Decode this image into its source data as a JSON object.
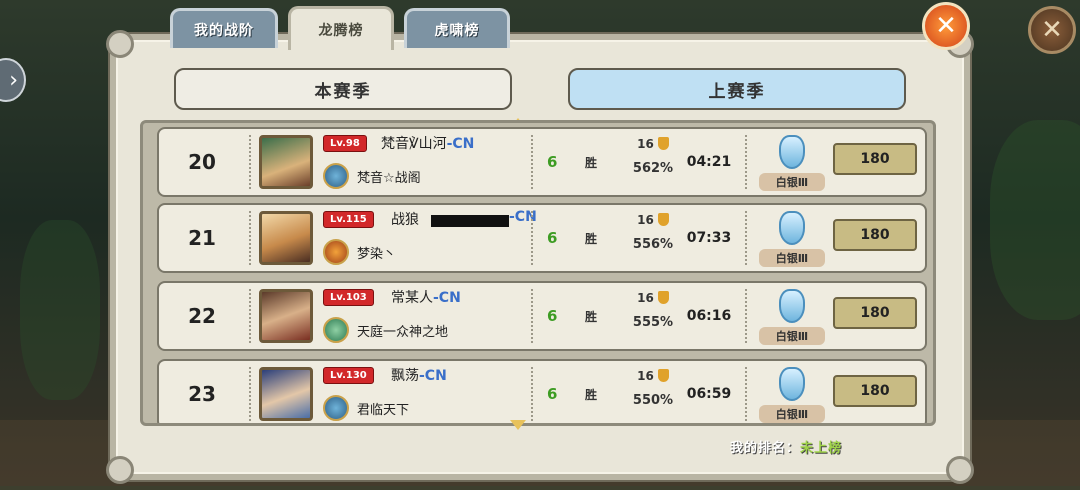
{
  "tabs": [
    {
      "label": "我的战阶",
      "active": false
    },
    {
      "label": "龙腾榜",
      "active": true
    },
    {
      "label": "虎啸榜",
      "active": false
    }
  ],
  "season_buttons": [
    {
      "label": "本赛季",
      "selected": false
    },
    {
      "label": "上赛季",
      "selected": true
    }
  ],
  "rows": [
    {
      "rank": "20",
      "level": "Lv.98",
      "name": "梵音℣山河",
      "server": "-CN",
      "guild": "梵音☆战阁",
      "wins": "6",
      "win_label": "胜",
      "streak": "16",
      "percent": "562%",
      "time": "04:21",
      "tier": "白银Ⅲ",
      "score": "180"
    },
    {
      "rank": "21",
      "level": "Lv.115",
      "name": "战狼",
      "server": "-CN",
      "guild": "梦染丶",
      "wins": "6",
      "win_label": "胜",
      "streak": "16",
      "percent": "556%",
      "time": "07:33",
      "tier": "白银Ⅲ",
      "score": "180"
    },
    {
      "rank": "22",
      "level": "Lv.103",
      "name": "常某人",
      "server": "-CN",
      "guild": "天庭一众神之地",
      "wins": "6",
      "win_label": "胜",
      "streak": "16",
      "percent": "555%",
      "time": "06:16",
      "tier": "白银Ⅲ",
      "score": "180"
    },
    {
      "rank": "23",
      "level": "Lv.130",
      "name": "飘荡",
      "server": "-CN",
      "guild": "君临天下",
      "wins": "6",
      "win_label": "胜",
      "streak": "16",
      "percent": "550%",
      "time": "06:59",
      "tier": "白银Ⅲ",
      "score": "180"
    }
  ],
  "my_rank": {
    "label": "我的排名：",
    "value": "未上榜"
  },
  "colors": {
    "accent_red": "#d2282a",
    "win_green": "#3d9c23",
    "server_blue": "#3a6fc9",
    "selected_tab": "#bfe0f3"
  },
  "icons": {
    "close": "close-x-icon",
    "nav": "chevron-right-icon",
    "tier": "silver-crest-icon",
    "streak": "shield-icon"
  }
}
